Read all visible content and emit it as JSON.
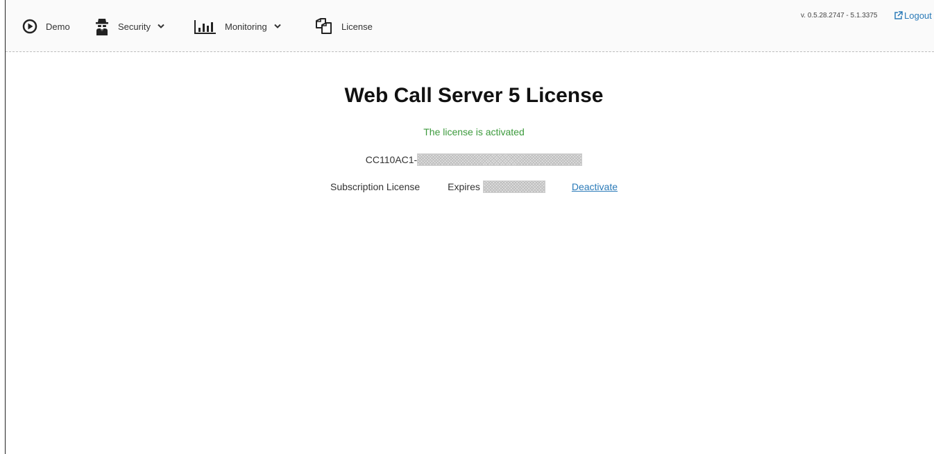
{
  "nav": {
    "items": [
      {
        "label": "Demo",
        "icon": "play-circle-icon",
        "has_dropdown": false
      },
      {
        "label": "Security",
        "icon": "spy-icon",
        "has_dropdown": true
      },
      {
        "label": "Monitoring",
        "icon": "bar-chart-icon",
        "has_dropdown": true
      },
      {
        "label": "License",
        "icon": "copy-documents-icon",
        "has_dropdown": false
      }
    ],
    "version": "v. 0.5.28.2747 - 5.1.3375",
    "logout_label": "Logout"
  },
  "license": {
    "title": "Web Call Server 5 License",
    "status": "The license is activated",
    "key_prefix": "CC110AC1-",
    "type": "Subscription License",
    "expires_label": "Expires",
    "deactivate_label": "Deactivate"
  },
  "colors": {
    "status_green": "#3c9a3c",
    "link_blue": "#2a7ab8"
  }
}
